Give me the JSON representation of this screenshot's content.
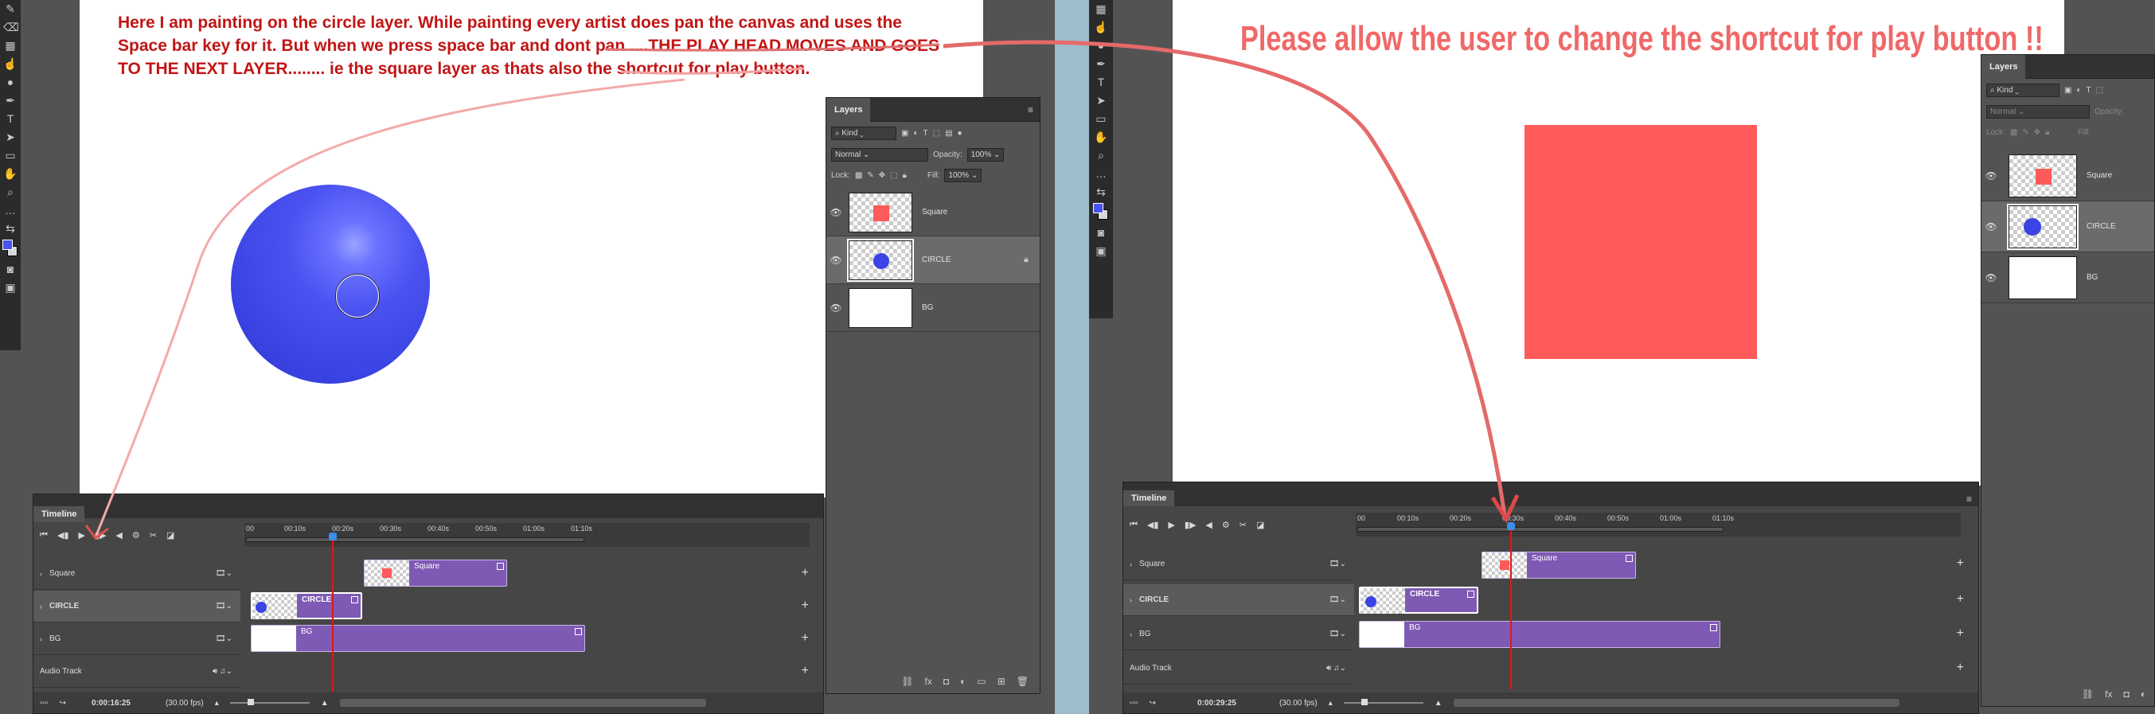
{
  "left": {
    "annotation": {
      "line1": "Here I am painting on the circle layer. While painting every artist does pan the canvas and uses the",
      "line2": "Space bar key for it. But when we press space bar and dont pan ....THE PLAY HEAD MOVES AND GOES",
      "line3": "TO THE NEXT LAYER........ ie the square layer as thats also the shortcut for play button."
    },
    "layers_panel": {
      "title": "Layers",
      "filter": "Kind",
      "blend_mode": "Normal",
      "opacity_label": "Opacity:",
      "opacity": "100%",
      "lock_label": "Lock:",
      "fill_label": "Fill:",
      "fill": "100%",
      "layers": [
        {
          "name": "Square",
          "selected": false
        },
        {
          "name": "CIRCLE",
          "selected": true
        },
        {
          "name": "BG",
          "selected": false
        }
      ]
    },
    "timeline": {
      "title": "Timeline",
      "ticks": [
        "00",
        "00:10s",
        "00:20s",
        "00:30s",
        "00:40s",
        "00:50s",
        "01:00s",
        "01:10s"
      ],
      "tracks": [
        "Square",
        "CIRCLE",
        "BG",
        "Audio Track"
      ],
      "clips": [
        "Square",
        "CIRCLE",
        "BG"
      ],
      "timecode": "0:00:16:25",
      "fps": "(30.00 fps)"
    }
  },
  "right": {
    "annotation": "Please  allow the user to change the shortcut for play button !!",
    "layers_panel": {
      "title": "Layers",
      "filter": "Kind",
      "blend_mode": "Normal",
      "opacity_label": "Opacity:",
      "lock_label": "Lock:",
      "fill_label": "Fill:",
      "layers": [
        {
          "name": "Square",
          "selected": false
        },
        {
          "name": "CIRCLE",
          "selected": true
        },
        {
          "name": "BG",
          "selected": false
        }
      ]
    },
    "timeline": {
      "title": "Timeline",
      "ticks": [
        "00",
        "00:10s",
        "00:20s",
        "00:30s",
        "00:40s",
        "00:50s",
        "01:00s",
        "01:10s"
      ],
      "tracks": [
        "Square",
        "CIRCLE",
        "BG",
        "Audio Track"
      ],
      "clips": [
        "Square",
        "CIRCLE",
        "BG"
      ],
      "timecode": "0:00:29:25",
      "fps": "(30.00 fps)"
    }
  },
  "colors": {
    "clip": "#7e5ab4",
    "square": "#ff5a5a",
    "circle": "#4a52f0",
    "annotation": "#c21515",
    "annotation_right": "#f06868",
    "playhead": "#e01818"
  },
  "icons": [
    "eye-icon",
    "lock-icon",
    "play-icon",
    "scissors-icon",
    "gear-icon",
    "plus-icon",
    "chevron-right-icon",
    "film-icon",
    "link-icon",
    "fx-icon",
    "trash-icon",
    "folder-icon"
  ]
}
